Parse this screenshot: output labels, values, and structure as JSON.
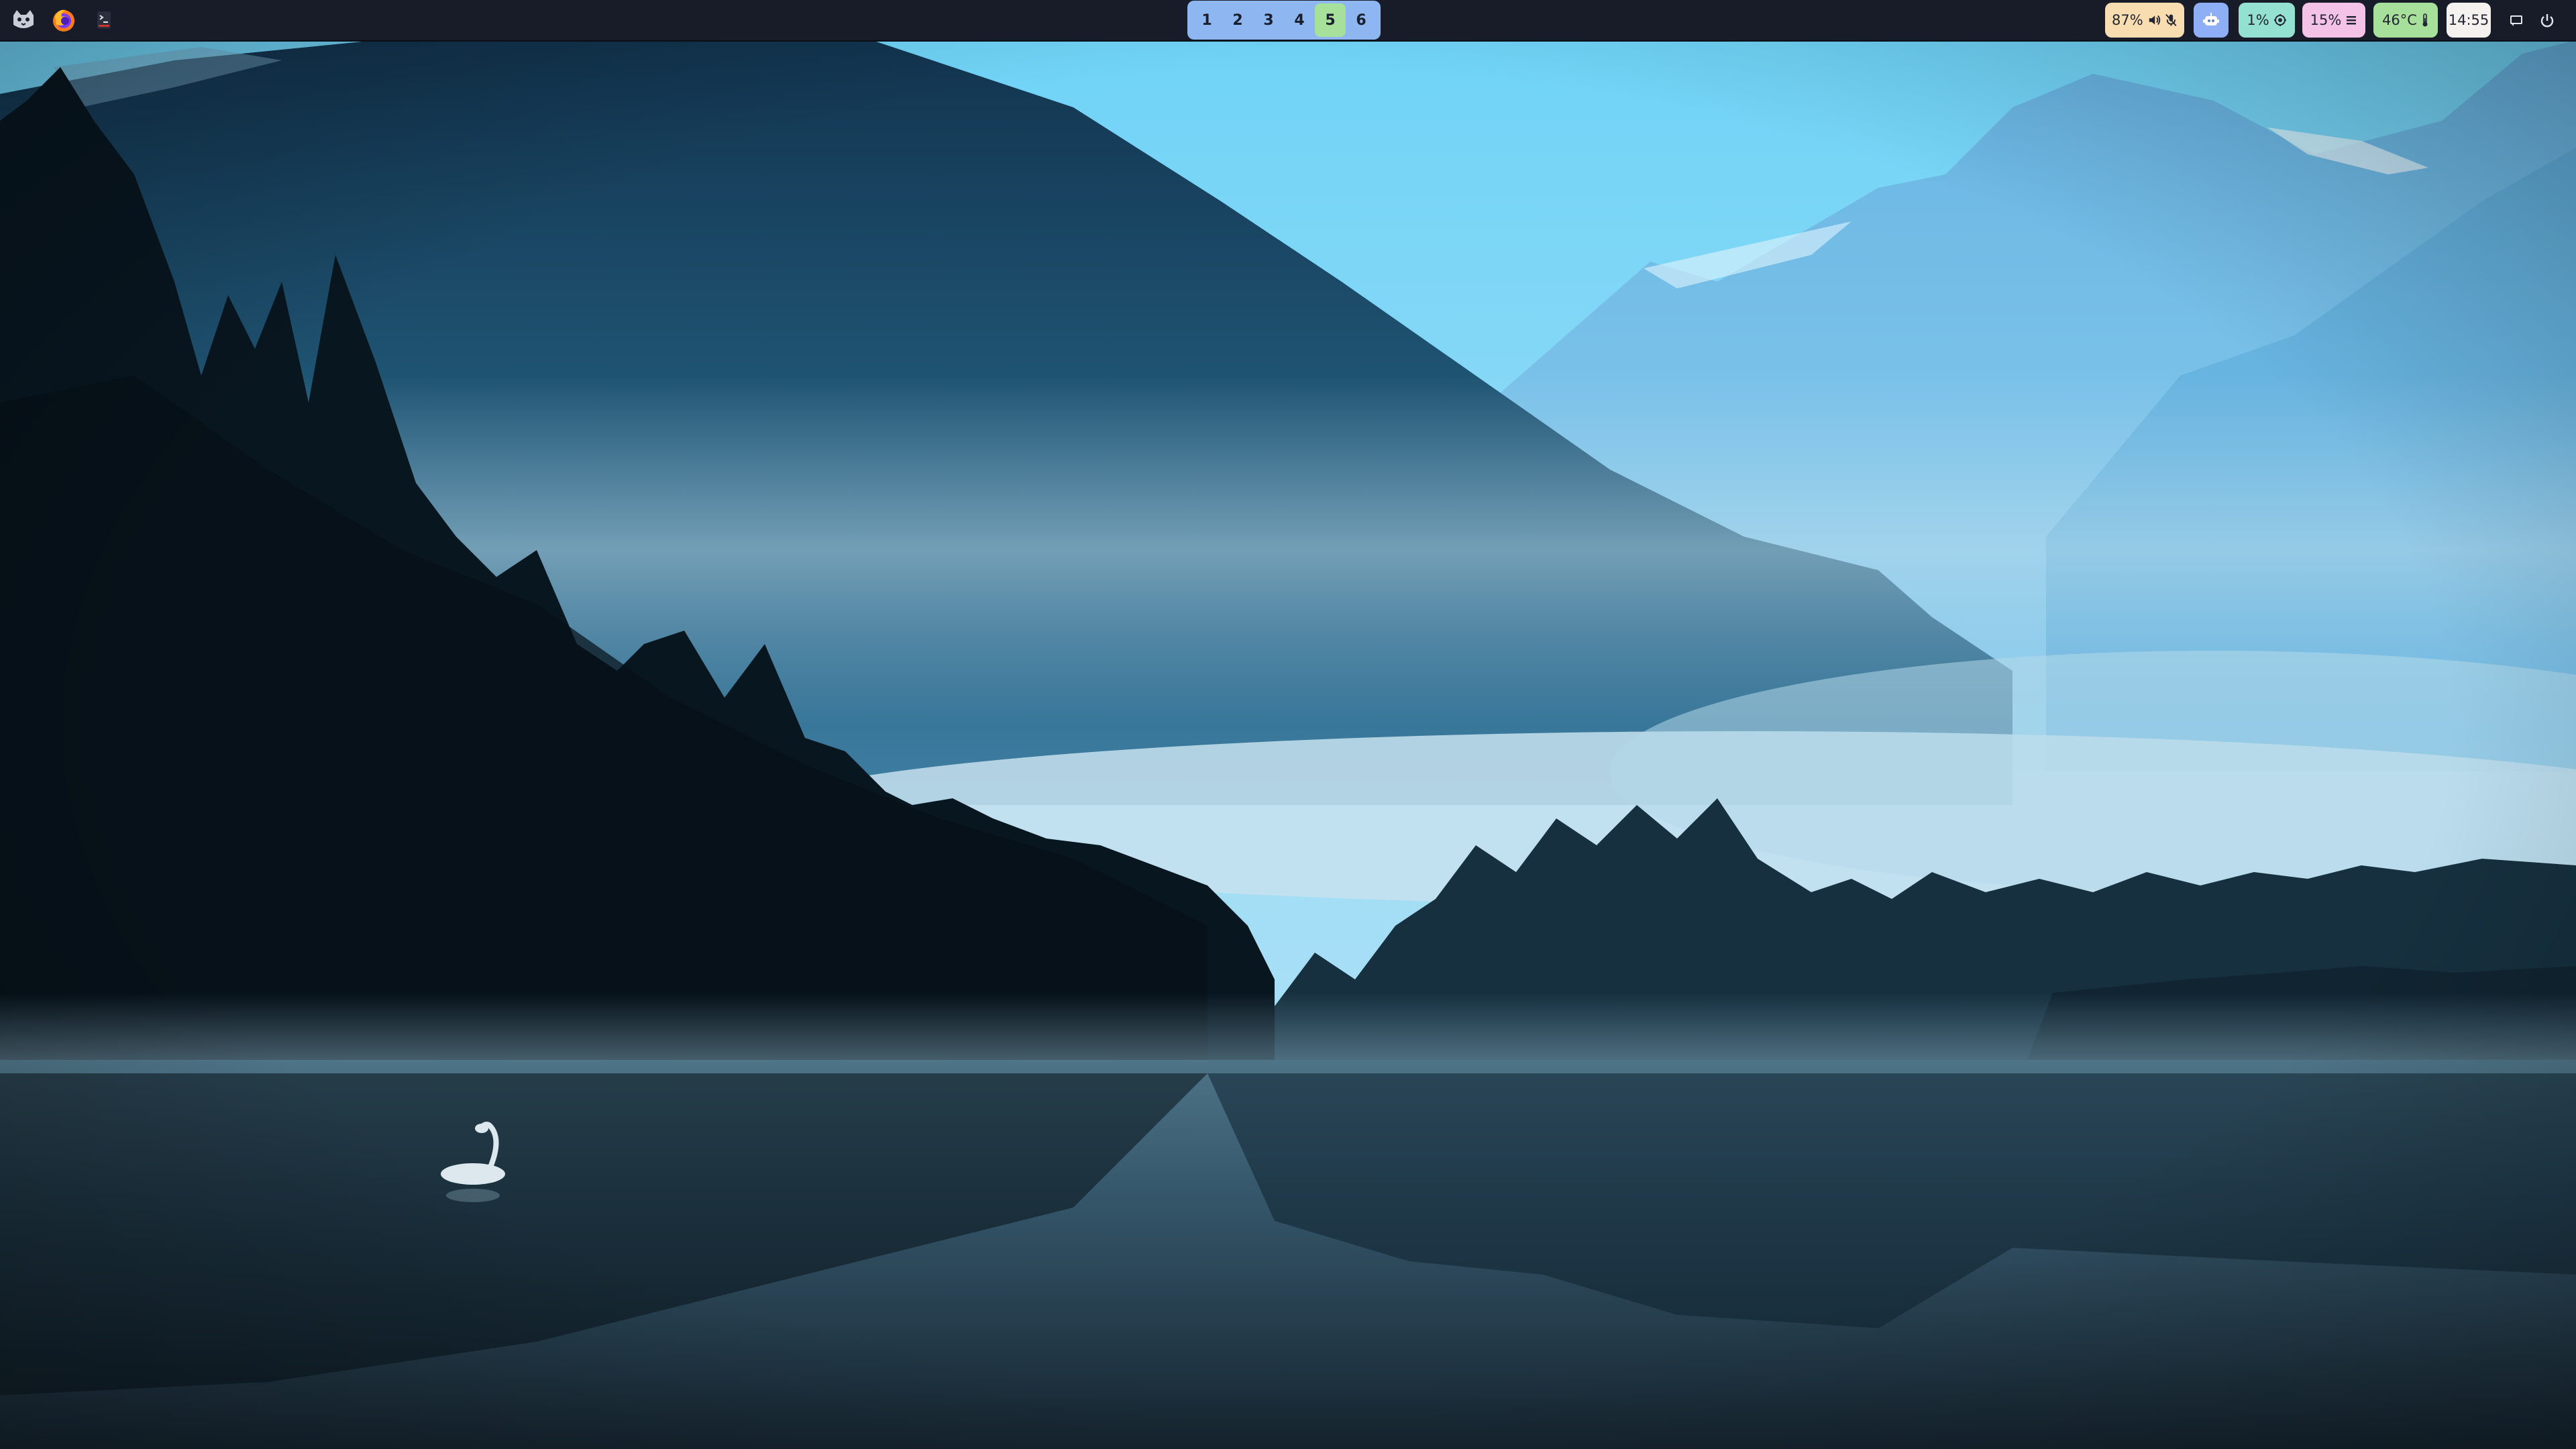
{
  "colors": {
    "bar_bg": "#181c29",
    "workspace_bg": "#8eb6f0",
    "workspace_active": "#a7e09a",
    "audio_bg": "#f7ddb0",
    "bot_bg": "#8eaef5",
    "cpu_bg": "#94e1d2",
    "memory_bg": "#f3c2e6",
    "temperature_bg": "#a7e09a",
    "clock_bg": "#f4f1ee",
    "module_text": "#232533"
  },
  "launchers": [
    {
      "icon": "cat-icon"
    },
    {
      "icon": "firefox-icon"
    },
    {
      "icon": "terminal-icon"
    }
  ],
  "workspaces": [
    {
      "label": "1",
      "active": false
    },
    {
      "label": "2",
      "active": false
    },
    {
      "label": "3",
      "active": false
    },
    {
      "label": "4",
      "active": false
    },
    {
      "label": "5",
      "active": true
    },
    {
      "label": "6",
      "active": false
    }
  ],
  "status": {
    "audio": {
      "text": "87%",
      "icons": [
        "volume-icon",
        "microphone-muted-icon"
      ]
    },
    "bot": {
      "icon": "robot-icon"
    },
    "cpu": {
      "text": "1%",
      "icon": "cpu-icon"
    },
    "memory": {
      "text": "15%",
      "icon": "memory-icon"
    },
    "temperature": {
      "text": "46°C",
      "icon": "thermometer-icon"
    },
    "clock": {
      "text": "14:55"
    }
  },
  "tray": [
    {
      "icon": "notification-icon"
    },
    {
      "icon": "power-icon"
    }
  ]
}
